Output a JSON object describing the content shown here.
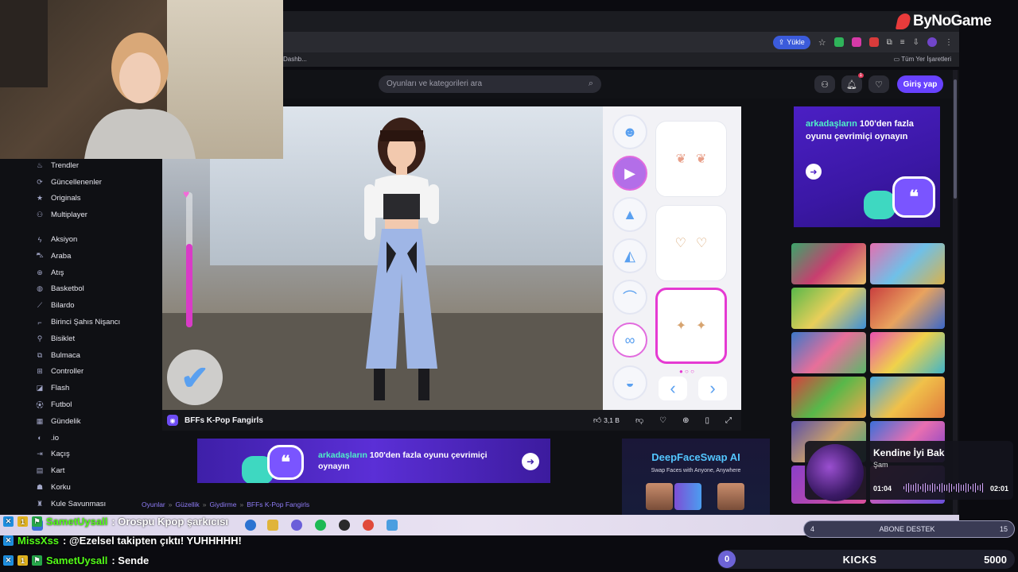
{
  "browser": {
    "upload_label": "Yükle",
    "bookmark_left": "Dashb...",
    "bookmark_right": "Tüm Yer İşaretleri"
  },
  "site": {
    "search_placeholder": "Oyunları ve kategorileri ara",
    "login_label": "Giriş yap",
    "notification_count": "1"
  },
  "sidebar": {
    "top_items": [
      {
        "label": "Trendler",
        "icon": "fire-icon"
      },
      {
        "label": "Güncellenenler",
        "icon": "refresh-icon"
      },
      {
        "label": "Originals",
        "icon": "star-icon"
      },
      {
        "label": "Multiplayer",
        "icon": "users-icon"
      }
    ],
    "categories": [
      {
        "label": "Aksiyon",
        "icon": "bolt-icon"
      },
      {
        "label": "Araba",
        "icon": "car-icon"
      },
      {
        "label": "Atış",
        "icon": "crosshair-icon"
      },
      {
        "label": "Basketbol",
        "icon": "basketball-icon"
      },
      {
        "label": "Bilardo",
        "icon": "cue-icon"
      },
      {
        "label": "Birinci Şahıs Nişancı",
        "icon": "gun-icon"
      },
      {
        "label": "Bisiklet",
        "icon": "bike-icon"
      },
      {
        "label": "Bulmaca",
        "icon": "puzzle-icon"
      },
      {
        "label": "Controller",
        "icon": "gamepad-icon"
      },
      {
        "label": "Flash",
        "icon": "flash-icon"
      },
      {
        "label": "Futbol",
        "icon": "soccer-icon"
      },
      {
        "label": "Gündelik",
        "icon": "grid-icon"
      },
      {
        "label": ".io",
        "icon": "io-icon"
      },
      {
        "label": "Kaçış",
        "icon": "escape-icon"
      },
      {
        "label": "Kart",
        "icon": "card-icon"
      },
      {
        "label": "Korku",
        "icon": "ghost-icon"
      },
      {
        "label": "Kule Savunması",
        "icon": "tower-icon"
      }
    ]
  },
  "game": {
    "title": "BFFs K-Pop Fangirls",
    "like_count": "3,1 B",
    "progress_level": 0.62,
    "categories": [
      "hair",
      "dress",
      "top",
      "skirt",
      "shoes",
      "earrings",
      "bag"
    ],
    "active_category": "earrings"
  },
  "promo": {
    "highlight": "arkadaşların",
    "text": " 100'den fazla oyunu çevrimiçi oynayın"
  },
  "side_ad": {
    "highlight": "arkadaşların",
    "text": " 100'den fazla oyunu çevrimiçi oynayın"
  },
  "dfs_ad": {
    "title": "DeepFaceSwap AI",
    "subtitle": "Swap Faces with Anyone, Anywhere"
  },
  "breadcrumb": [
    "Oyunlar",
    "Güzellik",
    "Giydirme",
    "BFFs K-Pop Fangirls"
  ],
  "music": {
    "title": "Kendine İyi Bak",
    "artist": "Şam",
    "current_time": "01:04",
    "total_time": "02:01"
  },
  "sub_goal": {
    "current": "4",
    "label": "ABONE DESTEK",
    "goal": "15"
  },
  "chat": [
    {
      "user": "SametUysall",
      "message": ": Orospu Kpop şarkıcısı",
      "badges": [
        "blue",
        "gold",
        "green"
      ]
    },
    {
      "user": "MissXss",
      "message": ": @Ezelsel takipten çıktı! YUHHHHH!",
      "badges": [
        "blue"
      ]
    },
    {
      "user": "SametUysall",
      "message": ": Sende",
      "badges": [
        "blue",
        "gold",
        "green"
      ]
    }
  ],
  "kicks": {
    "count": "0",
    "label": "KICKS",
    "goal": "5000"
  },
  "watermark": "ByNoGame",
  "colors": {
    "accent": "#6842ff",
    "chat_user": "#53fc18",
    "game_pink": "#e53ad2"
  }
}
